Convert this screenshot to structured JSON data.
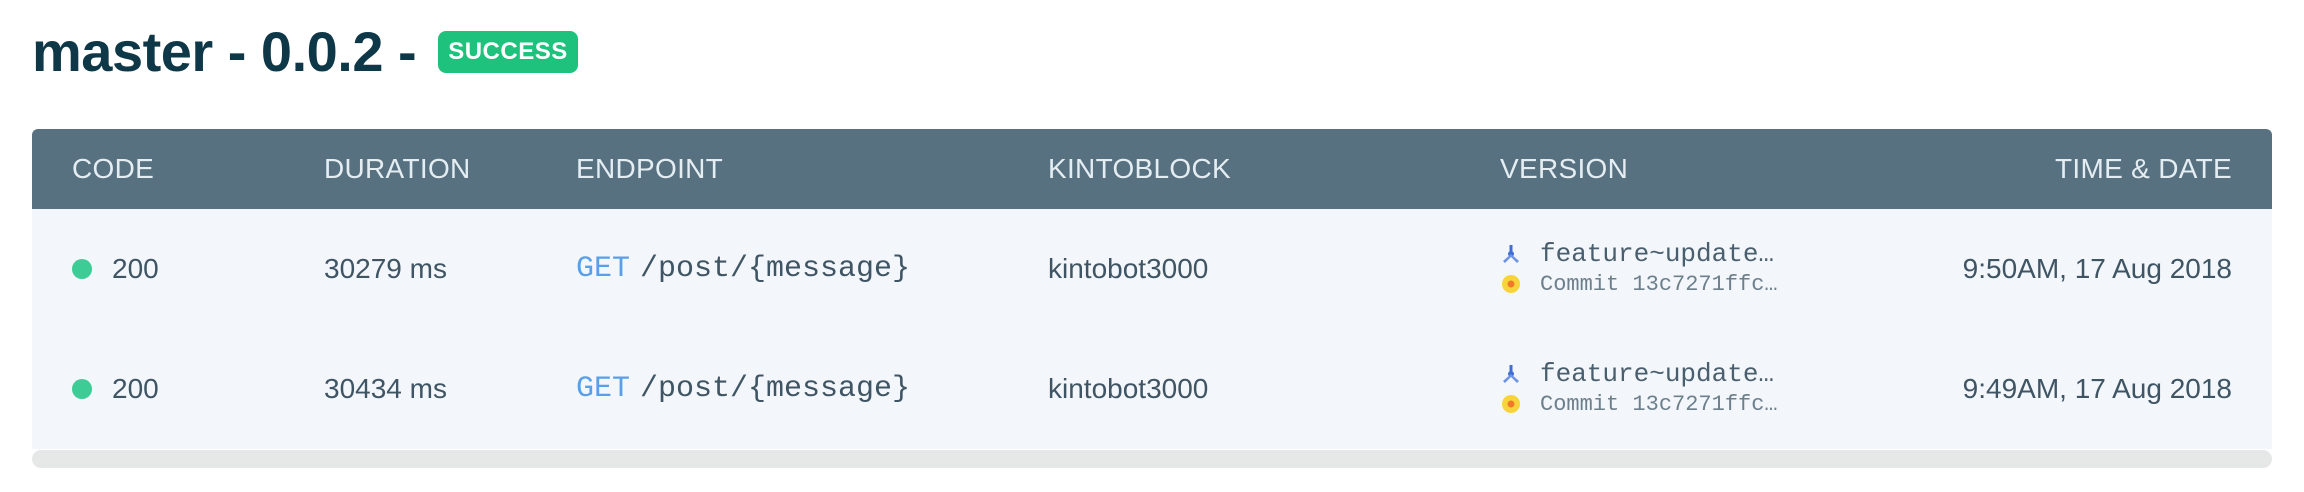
{
  "header": {
    "title": "master - 0.0.2 -",
    "status_badge": "SUCCESS"
  },
  "table": {
    "columns": [
      "CODE",
      "DURATION",
      "ENDPOINT",
      "KINTOBLOCK",
      "VERSION",
      "TIME & DATE"
    ],
    "rows": [
      {
        "status_color": "#3dcc95",
        "code": "200",
        "duration": "30279 ms",
        "method": "GET",
        "path": "/post/{message}",
        "kintoblock": "kintobot3000",
        "branch": "feature~update…",
        "commit": "Commit 13c7271ffc…",
        "time": "9:50AM, 17 Aug 2018"
      },
      {
        "status_color": "#3dcc95",
        "code": "200",
        "duration": "30434 ms",
        "method": "GET",
        "path": "/post/{message}",
        "kintoblock": "kintobot3000",
        "branch": "feature~update…",
        "commit": "Commit 13c7271ffc…",
        "time": "9:49AM, 17 Aug 2018"
      }
    ]
  },
  "icons": {
    "branch": "branch-icon",
    "commit": "commit-icon"
  },
  "colors": {
    "title": "#0e3847",
    "badge": "#1ec27c",
    "header_bg": "#577181",
    "row_bg": "#f3f6fb",
    "method": "#5aa0e8"
  }
}
